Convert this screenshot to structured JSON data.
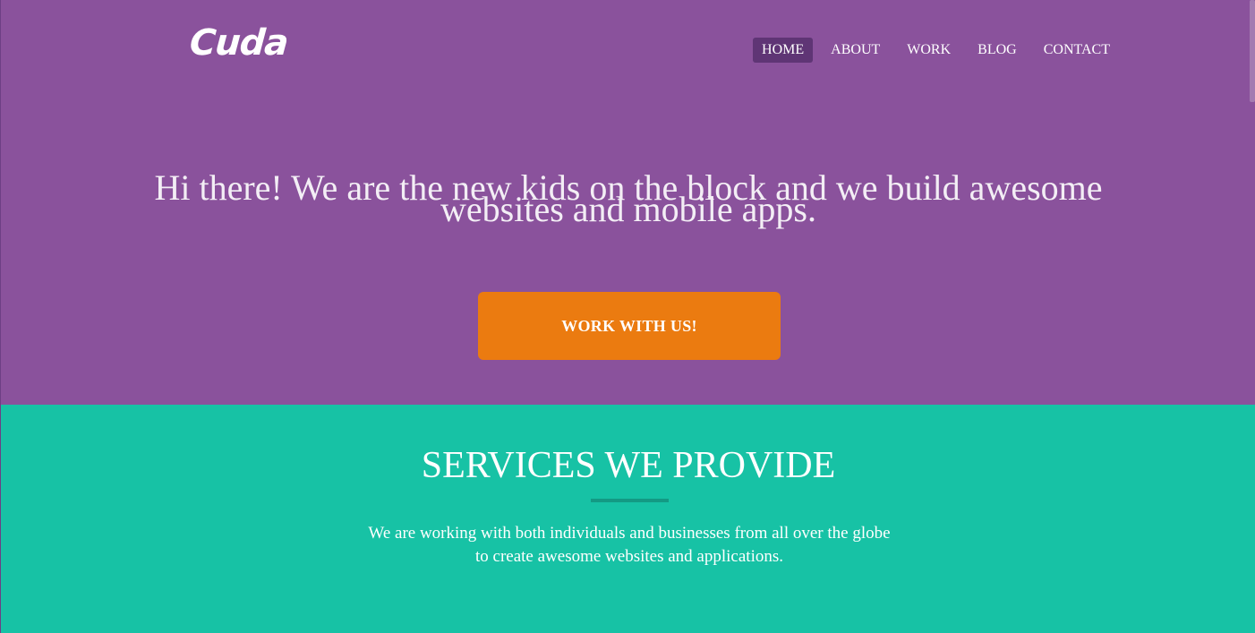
{
  "brand": {
    "logo_text": "Cuda"
  },
  "nav": {
    "items": [
      {
        "label": "HOME",
        "active": true
      },
      {
        "label": "ABOUT",
        "active": false
      },
      {
        "label": "WORK",
        "active": false
      },
      {
        "label": "BLOG",
        "active": false
      },
      {
        "label": "CONTACT",
        "active": false
      }
    ]
  },
  "hero": {
    "headline_line1": "Hi there! We are the new kids on the block and we build awesome",
    "headline_line2": "websites and mobile apps.",
    "cta_label": "WORK WITH US!"
  },
  "services": {
    "title": "SERVICES WE PROVIDE",
    "text_line1": "We are working with both individuals and businesses from all over the globe",
    "text_line2": "to create awesome websites and applications."
  },
  "colors": {
    "hero_bg": "#8a529c",
    "nav_active_bg": "#5f3575",
    "cta_bg": "#eb7b10",
    "services_bg": "#17c2a5",
    "divider": "#139a84"
  }
}
